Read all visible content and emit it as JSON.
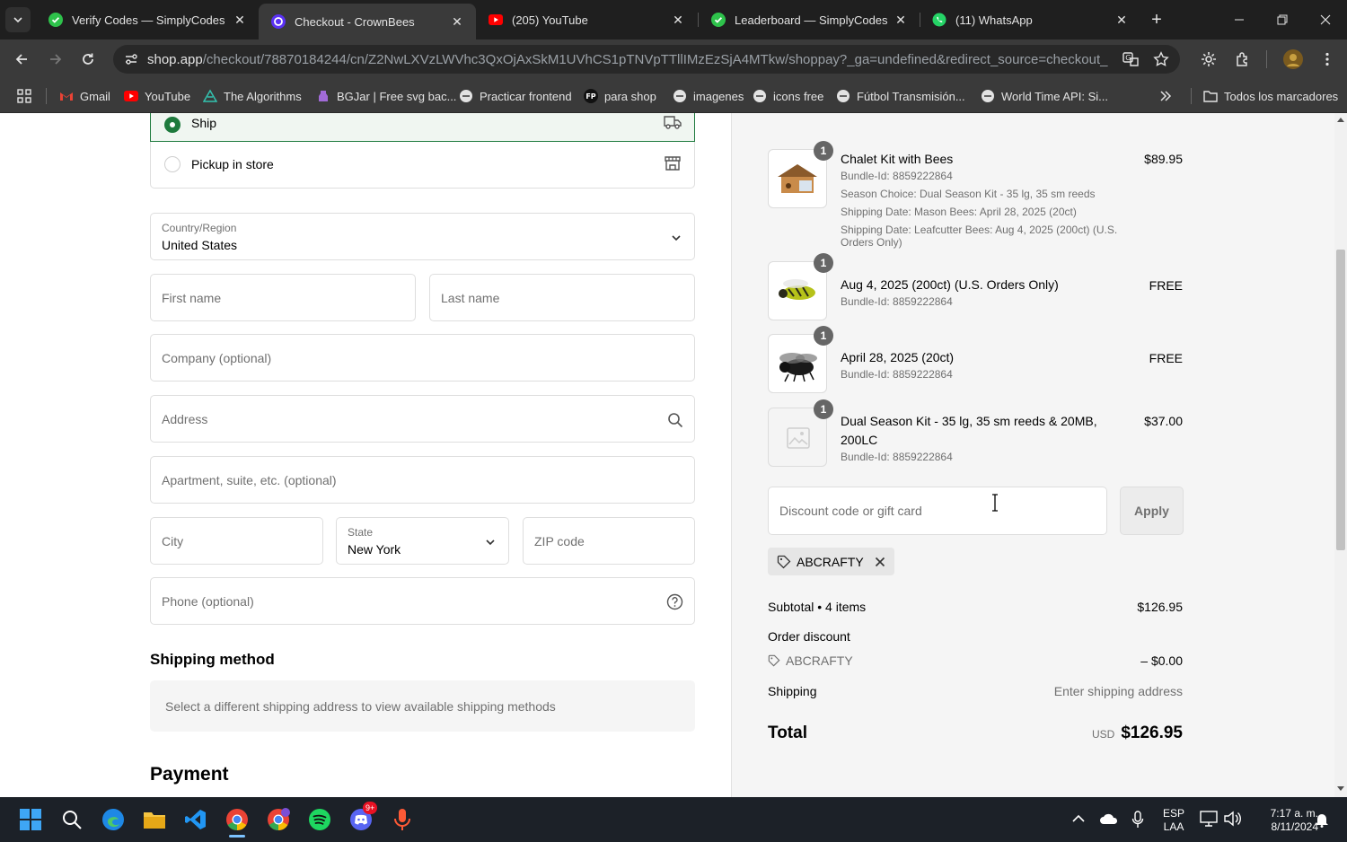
{
  "tabs": [
    {
      "title": "Verify Codes — SimplyCodes",
      "icon": "simplycodes-icon"
    },
    {
      "title": "Checkout - CrownBees",
      "icon": "shop-icon",
      "active": true
    },
    {
      "title": "(205) YouTube",
      "icon": "youtube-icon"
    },
    {
      "title": "Leaderboard — SimplyCodes",
      "icon": "simplycodes-icon"
    },
    {
      "title": "(11) WhatsApp",
      "icon": "whatsapp-icon"
    }
  ],
  "omnibox": {
    "host": "shop.app",
    "path": "/checkout/78870184244/cn/Z2NwLXVzLWVhc3QxOjAxSkM1UVhCS1pTNVpTTllIMzEzSjA4MTkw/shoppay?_ga=undefined&redirect_source=checkout_autom..."
  },
  "bookmarks": [
    "Gmail",
    "YouTube",
    "The Algorithms",
    "BGJar | Free svg bac...",
    "Practicar frontend",
    "para shop",
    "imagenes",
    "icons free",
    "Fútbol Transmisión...",
    "World Time API: Si..."
  ],
  "bookmarks_all": "Todos los marcadores",
  "delivery": {
    "ship": "Ship",
    "pickup": "Pickup in store"
  },
  "form": {
    "country_label": "Country/Region",
    "country_value": "United States",
    "first_name": "First name",
    "last_name": "Last name",
    "company": "Company (optional)",
    "address": "Address",
    "apartment": "Apartment, suite, etc. (optional)",
    "city": "City",
    "state_label": "State",
    "state_value": "New York",
    "zip": "ZIP code",
    "phone": "Phone (optional)"
  },
  "shipping_method": {
    "title": "Shipping method",
    "message": "Select a different shipping address to view available shipping methods"
  },
  "payment_title": "Payment",
  "items": [
    {
      "qty": "1",
      "name": "Chalet Kit with Bees",
      "price": "$89.95",
      "details": [
        "Bundle-Id: 8859222864",
        "Season Choice: Dual Season Kit - 35 lg, 35 sm reeds",
        "Shipping Date: Mason Bees: April 28, 2025 (20ct)",
        "Shipping Date: Leafcutter Bees: Aug 4, 2025 (200ct) (U.S.",
        "Orders Only)"
      ]
    },
    {
      "qty": "1",
      "name": "Aug 4, 2025 (200ct) (U.S. Orders Only)",
      "price": "FREE",
      "details": [
        "Bundle-Id: 8859222864"
      ]
    },
    {
      "qty": "1",
      "name": "April 28, 2025 (20ct)",
      "price": "FREE",
      "details": [
        "Bundle-Id: 8859222864"
      ]
    },
    {
      "qty": "1",
      "name": "Dual Season Kit - 35 lg, 35 sm reeds & 20MB,",
      "name2": "200LC",
      "price": "$37.00",
      "details": [
        "Bundle-Id: 8859222864"
      ]
    }
  ],
  "discount": {
    "placeholder": "Discount code or gift card",
    "apply": "Apply",
    "code": "ABCRAFTY"
  },
  "summary": {
    "subtotal_label": "Subtotal • 4 items",
    "subtotal": "$126.95",
    "order_discount_label": "Order discount",
    "discount_code": "ABCRAFTY",
    "discount_value": "– $0.00",
    "shipping_label": "Shipping",
    "shipping_value": "Enter shipping address",
    "total_label": "Total",
    "currency": "USD",
    "total": "$126.95"
  },
  "taskbar": {
    "lang1": "ESP",
    "lang2": "LAA",
    "time": "7:17 a. m.",
    "date": "8/11/2024",
    "badge": "9+"
  }
}
